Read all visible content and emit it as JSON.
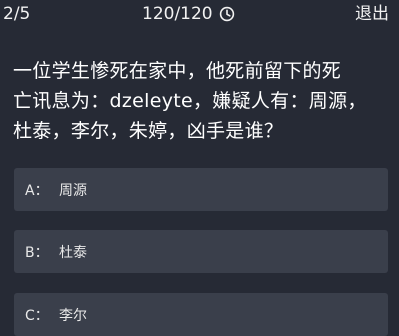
{
  "header": {
    "progress": "2/5",
    "timer": "120/120",
    "timer_icon": "clock-icon",
    "exit_label": "退出"
  },
  "question": {
    "lines": [
      "一位学生惨死在家中，他死前留下的死",
      "亡讯息为：dzeleyte，嫌疑人有：周源，",
      "杜泰，李尔，朱婷，凶手是谁？"
    ]
  },
  "options": [
    {
      "key": "A：",
      "text": "周源"
    },
    {
      "key": "B：",
      "text": "杜泰"
    },
    {
      "key": "C：",
      "text": "李尔"
    }
  ],
  "colors": {
    "background": "#262a35",
    "option_background": "#3a3f4b",
    "text": "#ffffff"
  }
}
